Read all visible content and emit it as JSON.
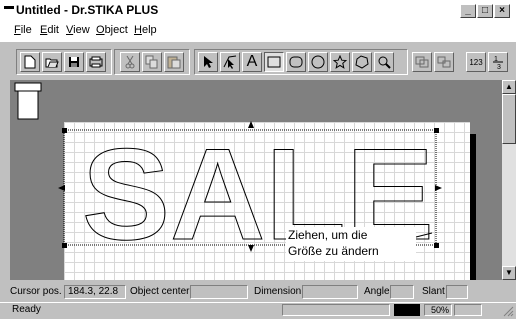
{
  "window": {
    "title": "Untitled - Dr.STIKA PLUS",
    "btn_min": "_",
    "btn_max": "□",
    "btn_close": "×"
  },
  "menu": [
    {
      "key": "F",
      "rest": "ile"
    },
    {
      "key": "E",
      "rest": "dit"
    },
    {
      "key": "V",
      "rest": "iew"
    },
    {
      "key": "O",
      "rest": "bject"
    },
    {
      "key": "H",
      "rest": "elp"
    }
  ],
  "toolbar": {
    "text_tool_label": "A",
    "num_label": "123"
  },
  "canvas": {
    "text": "SALE",
    "annotation_line1": "Ziehen, um die",
    "annotation_line2": "Größe zu ändern"
  },
  "status": {
    "cursor_label": "Cursor pos.",
    "cursor_value": "184.3, 22.8",
    "object_center_label": "Object center",
    "object_center_value": "",
    "dimension_label": "Dimension",
    "dimension_value": "",
    "angle_label": "Angle",
    "angle_value": "",
    "slant_label": "Slant",
    "slant_value": "",
    "ready": "Ready",
    "zoom": "50%"
  }
}
